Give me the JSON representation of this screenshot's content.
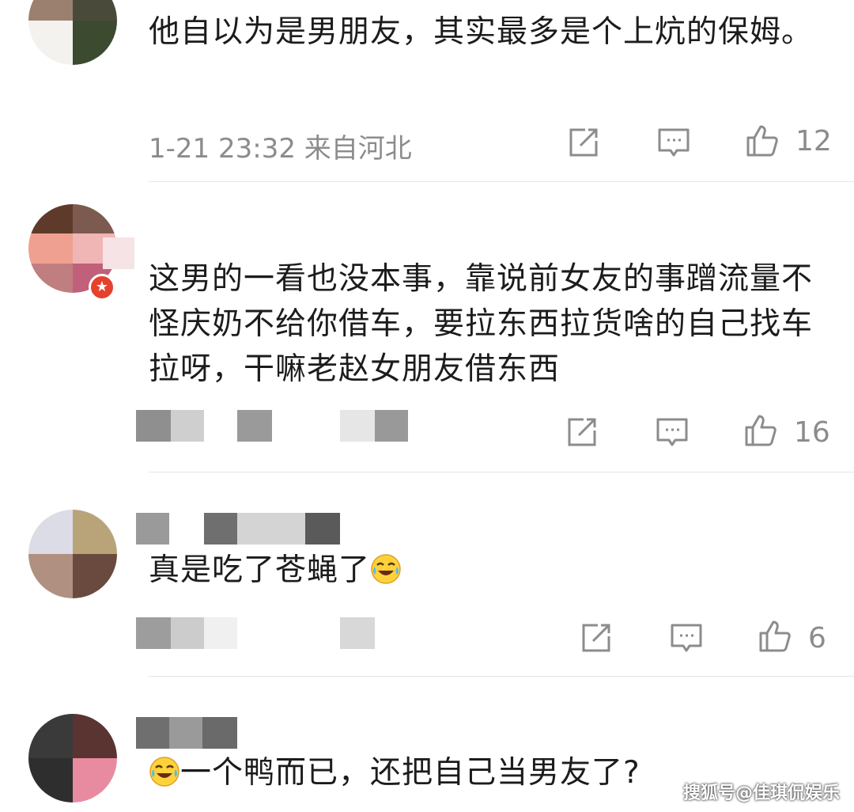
{
  "comments": [
    {
      "text": "他自以为是男朋友，其实最多是个上炕的保姆。",
      "meta": "1-21 23:32  来自河北",
      "likes": "12",
      "avatar_colors": [
        "#9b7f6f",
        "#4a4a3a",
        "#f3f2ee",
        "#3c4a30"
      ]
    },
    {
      "text": "这男的一看也没本事，靠说前女友的事蹭流量不怪庆奶不给你借车，要拉东西拉货啥的自己找车拉呀，干嘛老赵女朋友借东西",
      "likes": "16",
      "avatar_colors": [
        "#5e3a2a",
        "#7d5a4f",
        "#f0a090",
        "#f0b5b5",
        "#c07e80",
        "#c0607a"
      ]
    },
    {
      "text": "真是吃了苍蝇了",
      "likes": "6",
      "avatar_colors": [
        "#dcdce6",
        "#b8a478",
        "#b09080",
        "#6a4a3e"
      ]
    },
    {
      "text": "一个鸭而已，还把自己当男友了?",
      "avatar_colors": [
        "#3a3a3a",
        "#5a3430",
        "#2e2e2e",
        "#e88aa0"
      ]
    }
  ],
  "icons": {
    "share": "share-icon",
    "comment": "comment-icon",
    "like": "thumbs-up-icon",
    "emoji": "laughing-tears-emoji"
  },
  "watermark": "搜狐号@佳琪侃娱乐",
  "colors": {
    "meta_gray": "#8c8c8c",
    "divider": "#e6e6e6",
    "badge_red": "#e5412d"
  }
}
